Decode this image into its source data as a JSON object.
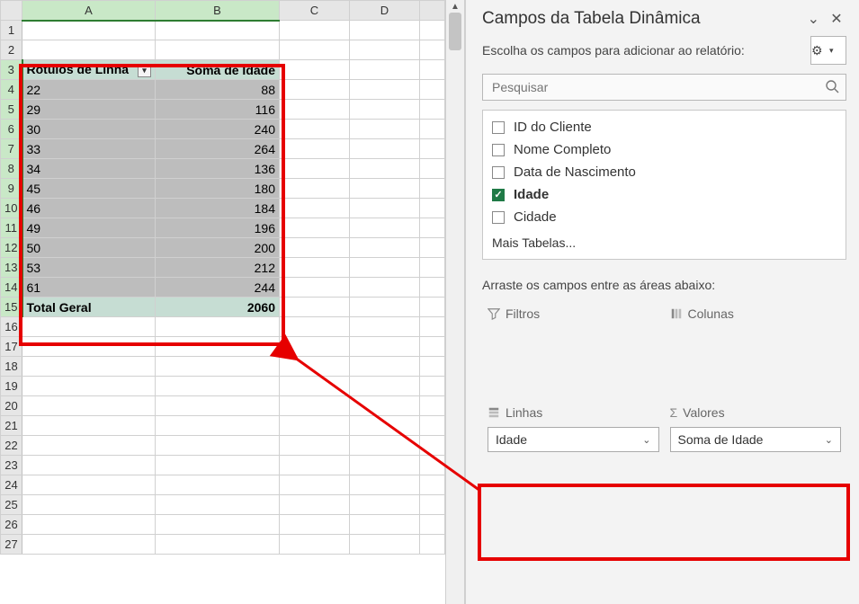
{
  "sheet": {
    "columns": [
      "A",
      "B",
      "C",
      "D"
    ],
    "rows": [
      1,
      2,
      3,
      4,
      5,
      6,
      7,
      8,
      9,
      10,
      11,
      12,
      13,
      14,
      15,
      16,
      17,
      18,
      19,
      20,
      21,
      22,
      23,
      24,
      25,
      26,
      27
    ],
    "pivot_header": {
      "row_label": "Rótulos de Linha",
      "value_label": "Soma de Idade"
    },
    "pivot_data": [
      {
        "k": "22",
        "v": "88"
      },
      {
        "k": "29",
        "v": "116"
      },
      {
        "k": "30",
        "v": "240"
      },
      {
        "k": "33",
        "v": "264"
      },
      {
        "k": "34",
        "v": "136"
      },
      {
        "k": "45",
        "v": "180"
      },
      {
        "k": "46",
        "v": "184"
      },
      {
        "k": "49",
        "v": "196"
      },
      {
        "k": "50",
        "v": "200"
      },
      {
        "k": "53",
        "v": "212"
      },
      {
        "k": "61",
        "v": "244"
      }
    ],
    "total_label": "Total Geral",
    "total_value": "2060"
  },
  "pane": {
    "title": "Campos da Tabela Dinâmica",
    "subtitle": "Escolha os campos para adicionar ao relatório:",
    "search_placeholder": "Pesquisar",
    "fields": [
      {
        "label": "ID do Cliente",
        "checked": false
      },
      {
        "label": "Nome Completo",
        "checked": false
      },
      {
        "label": "Data de Nascimento",
        "checked": false
      },
      {
        "label": "Idade",
        "checked": true
      },
      {
        "label": "Cidade",
        "checked": false
      }
    ],
    "more_tables": "Mais Tabelas...",
    "drag_hint": "Arraste os campos entre as áreas abaixo:",
    "zones": {
      "filters": "Filtros",
      "columns": "Colunas",
      "rows": "Linhas",
      "values": "Valores",
      "rows_value": "Idade",
      "values_value": "Soma de Idade"
    }
  }
}
